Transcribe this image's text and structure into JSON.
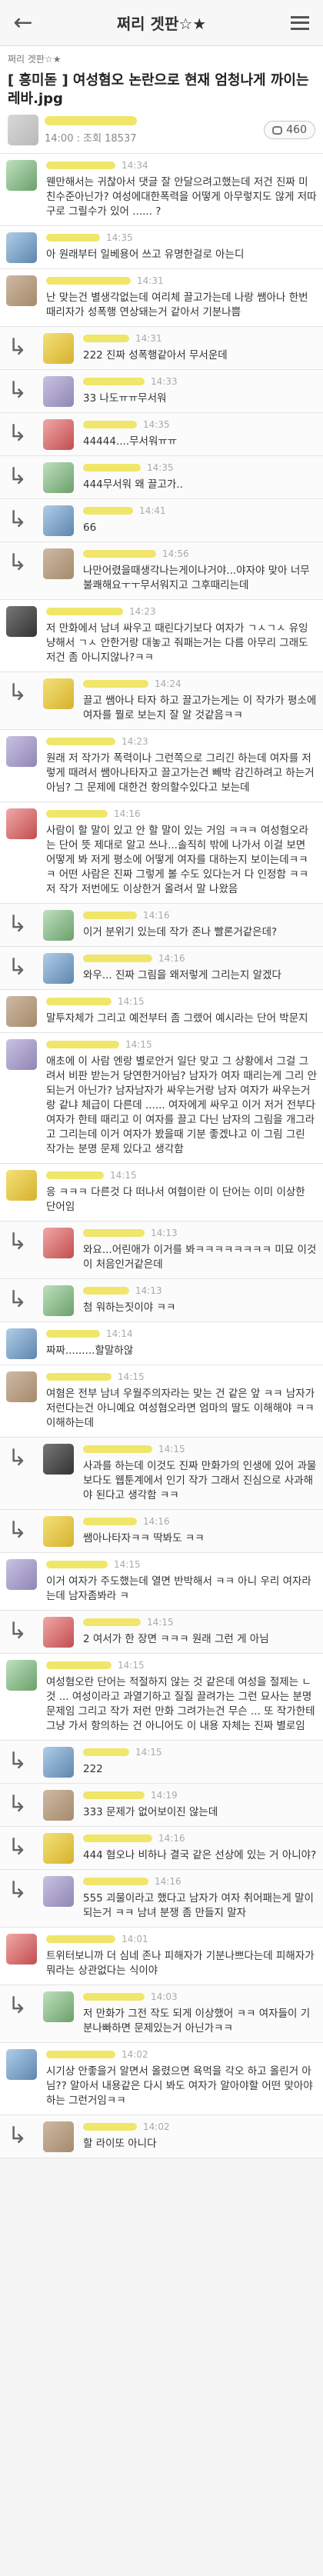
{
  "header": {
    "title": "쩌리 겟판☆★"
  },
  "post": {
    "board": "쩌리 겟판☆★",
    "title": "[ 흥미돋 ] 여성혐오 논란으로 현재 엄청나게 까이는 레바.jpg",
    "meta": "14:00 : 조회 18537",
    "comment_count": "460"
  },
  "comments": [
    {
      "reply": false,
      "time": "14:34",
      "text": "웬만해서는 귀찮아서 댓글 잘 안달으려고했는데 저건 진짜 미친수준아닌가? 여성에대한폭력을 어떻게 아무렇지도 않게 저따구로 그릴수가 있어 ...... ?",
      "av": "av-g",
      "nb": 90
    },
    {
      "reply": false,
      "time": "14:35",
      "text": "아 원래부터 일베용어 쓰고 유명한걸로 아는디",
      "av": "av-b",
      "nb": 70
    },
    {
      "reply": false,
      "time": "14:31",
      "text": "난 맞는건 별생각없는데 여리체 끌고가는데 나랑 쌤아나 한번때리자가 성폭행 연상돼는거 같아서 기분나쁨",
      "av": "av-c",
      "nb": 110
    },
    {
      "reply": true,
      "time": "14:31",
      "text": "222 진짜 성폭행같아서 무서운데",
      "av": "av-y",
      "nb": 60
    },
    {
      "reply": true,
      "time": "14:33",
      "text": "33 나도ㅠㅠ무서워",
      "av": "av-p",
      "nb": 80
    },
    {
      "reply": true,
      "time": "14:35",
      "text": "44444....무서워ㅠㅠ",
      "av": "av-r",
      "nb": 70
    },
    {
      "reply": true,
      "time": "14:35",
      "text": "444무서워 왜 끌고가..",
      "av": "av-g",
      "nb": 75
    },
    {
      "reply": true,
      "time": "14:41",
      "text": "66",
      "av": "av-b",
      "nb": 65
    },
    {
      "reply": true,
      "time": "14:56",
      "text": "나만어렸을때생각나는게이나거야...야자야 맞아 너무 불쾌해요ㅜㅜ무서워지고 그후때리는데",
      "av": "av-c",
      "nb": 95
    },
    {
      "reply": false,
      "time": "14:23",
      "text": "저 만화에서 남녀 싸우고 때린다기보다 여자가 ㄱㅅㄱㅅ 유잉냥해서 ㄱㅅ 안한거랑 대놓고 줘패는거는 다름 아무리 그래도 저건 좀 아니지않나?ㅋㅋ",
      "av": "av-d",
      "nb": 100
    },
    {
      "reply": true,
      "time": "14:24",
      "text": "끌고 쌤아나 타자 하고 끌고가는게는 이 작가가 평소에 여자를 뭘로 보는지 잘 알 것같음ㅋㅋ",
      "av": "av-y",
      "nb": 85
    },
    {
      "reply": false,
      "time": "14:23",
      "text": "원래 저 작가가 폭력이나 그런쪽으로 그리긴 하는데 여자를 저렇게 때려서 쌤아나타자고 끌고가는건 빼박 감긴하려고 하는거 아님? 그 문제에 대한건 항의할수있다고 보는데",
      "av": "av-p",
      "nb": 90
    },
    {
      "reply": false,
      "time": "14:16",
      "text": "사람이 할 말이 있고 안 할 말이 있는 거임 ㅋㅋㅋ 여성혐오라는 단어 뜻 제대로 알고 쓰나...솔직히 밖에 나가서 이걸 보면 어떻게 봐 저게 평소에 어떻게 여자를 대하는지 보이는데ㅋㅋㅋ 어떤 사람은 진짜 그렇게 볼 수도 있다는거 다 인정함 ㅋㅋ 저 작가 저번에도 이상한거 올려서 말 나왔음",
      "av": "av-r",
      "nb": 80
    },
    {
      "reply": true,
      "time": "14:16",
      "text": "이거 분위기 있는데 작가 존나 빨론거같은데?",
      "av": "av-g",
      "nb": 70
    },
    {
      "reply": true,
      "time": "14:16",
      "text": "와우... 진짜 그림을 왜저렇게 그리는지 알겠다",
      "av": "av-b",
      "nb": 90
    },
    {
      "reply": false,
      "time": "14:15",
      "text": "말투자체가 그리고 예전부터 좀 그랬어 예시라는 단어 박문지",
      "av": "av-c",
      "nb": 85
    },
    {
      "reply": false,
      "time": "14:15",
      "text": "애초에 이 사람 엔랑 별로안거 일단 맞고 그 상황에서 그걸 그려서 비판 받는거 당연한거아님? 남자가 여자 때리는게 그리 안되는거 아닌가? 남자남자가 싸우는거랑 남자 여자가 싸우는거랑 같냐 체급이 다른데 ...... 여자에게 싸우고 이거 저거 전부다 여자가 한테 때리고 이 여자를 끌고 다닌 남자의 그림을 개그라고 그리는데 이거 여자가 봤을때 기분 좋겠냐고 이 그림 그린 작가는 분명 문제 있다고 생각함",
      "av": "av-p",
      "nb": 95
    },
    {
      "reply": false,
      "time": "14:15",
      "text": "응 ㅋㅋㅋ 다른것 다 떠나서 여혐이란 이 단어는 이미 이상한 단어임",
      "av": "av-y",
      "nb": 75
    },
    {
      "reply": true,
      "time": "14:13",
      "text": "와요...어린애가 이거를 봐ㅋㅋㅋㅋㅋㅋㅋㅋ 미묘 이것이 처음인거같은데",
      "av": "av-r",
      "nb": 80
    },
    {
      "reply": true,
      "time": "14:13",
      "text": "첨 워하는짓이야 ㅋㅋ",
      "av": "av-g",
      "nb": 60
    },
    {
      "reply": false,
      "time": "14:14",
      "text": "짜짜.........할말하않",
      "av": "av-b",
      "nb": 70
    },
    {
      "reply": false,
      "time": "14:15",
      "text": "여혐은 전부 남녀 우월주의자라는 맞는 건 같은 앞 ㅋㅋ 남자가 저런다는건 아니예요 여성혐오라면 엄마의 딸도 이해해야 ㅋㅋ 이해하는데",
      "av": "av-c",
      "nb": 85
    },
    {
      "reply": true,
      "time": "14:15",
      "text": "사과를 하는데 이것도 진짜 만화가의 인생에 있어 과물 보다도 웹툰계에서 인기 작가 그래서 진심으로 사과해야 된다고 생각함 ㅋㅋ",
      "av": "av-d",
      "nb": 90
    },
    {
      "reply": true,
      "time": "14:16",
      "text": "쌤아나타자ㅋㅋ 딱봐도 ㅋㅋ",
      "av": "av-y",
      "nb": 70
    },
    {
      "reply": false,
      "time": "14:15",
      "text": "이거 여자가 주도했는데 열면 반박해서 ㅋㅋ 아니 우리 여자라는데 남자좀봐라 ㅋ",
      "av": "av-p",
      "nb": 80
    },
    {
      "reply": true,
      "time": "14:15",
      "text": "2 여서가 한 장면 ㅋㅋㅋ 원래 그런 게 아님",
      "av": "av-r",
      "nb": 75
    },
    {
      "reply": false,
      "time": "14:15",
      "text": "여성혐오란 단어는 적절하지 않는 것 같은데 여성을 절제는 ㄴ 것 ... 여성이라고 과열기하고 질질 끌려가는 그런 묘사는 분명 문제임 그리고 작가 저런 만화 그려가는건 무슨 ... 또 작가한테 그냥 가서 항의하는 건 아니어도 이 내용 자체는 진짜 별로임",
      "av": "av-g",
      "nb": 85
    },
    {
      "reply": true,
      "time": "14:15",
      "text": "222",
      "av": "av-b",
      "nb": 60
    },
    {
      "reply": true,
      "time": "14:19",
      "text": "333 문제가 없어보이진 않는데",
      "av": "av-c",
      "nb": 80
    },
    {
      "reply": true,
      "time": "14:16",
      "text": "444 혐오나 비하나 결국 같은 선상에 있는 거 아니야?",
      "av": "av-y",
      "nb": 90
    },
    {
      "reply": true,
      "time": "14:16",
      "text": "555 괴물이라고 했다고 남자가 여자 취어패는게 말이 되는거 ㅋㅋ 남녀 분쟁 좀 만들지 말자",
      "av": "av-p",
      "nb": 85
    },
    {
      "reply": false,
      "time": "14:01",
      "text": "트위터보니까 더 심네 존나 피해자가 기분나쁘다는데 피해자가 뭐라는 상관없다는 식이야",
      "av": "av-r",
      "nb": 90
    },
    {
      "reply": true,
      "time": "14:03",
      "text": "저 만화가 그전 작도 되게 이상했어 ㅋㅋ 여자들이 기분나빠하면 문제있는거 아닌가ㅋㅋ",
      "av": "av-g",
      "nb": 80
    },
    {
      "reply": false,
      "time": "14:02",
      "text": "시기상 안좋을거 알면서 올렸으면 욕먹을 각오 하고 올린거 아님?? 알아서 내용같은 다시 봐도 여자가 알아야할 어떤 맞아야하는 그런거임ㅋㅋ",
      "av": "av-b",
      "nb": 90
    },
    {
      "reply": true,
      "time": "14:02",
      "text": "할 라이또 아니다",
      "av": "av-c",
      "nb": 70
    }
  ]
}
